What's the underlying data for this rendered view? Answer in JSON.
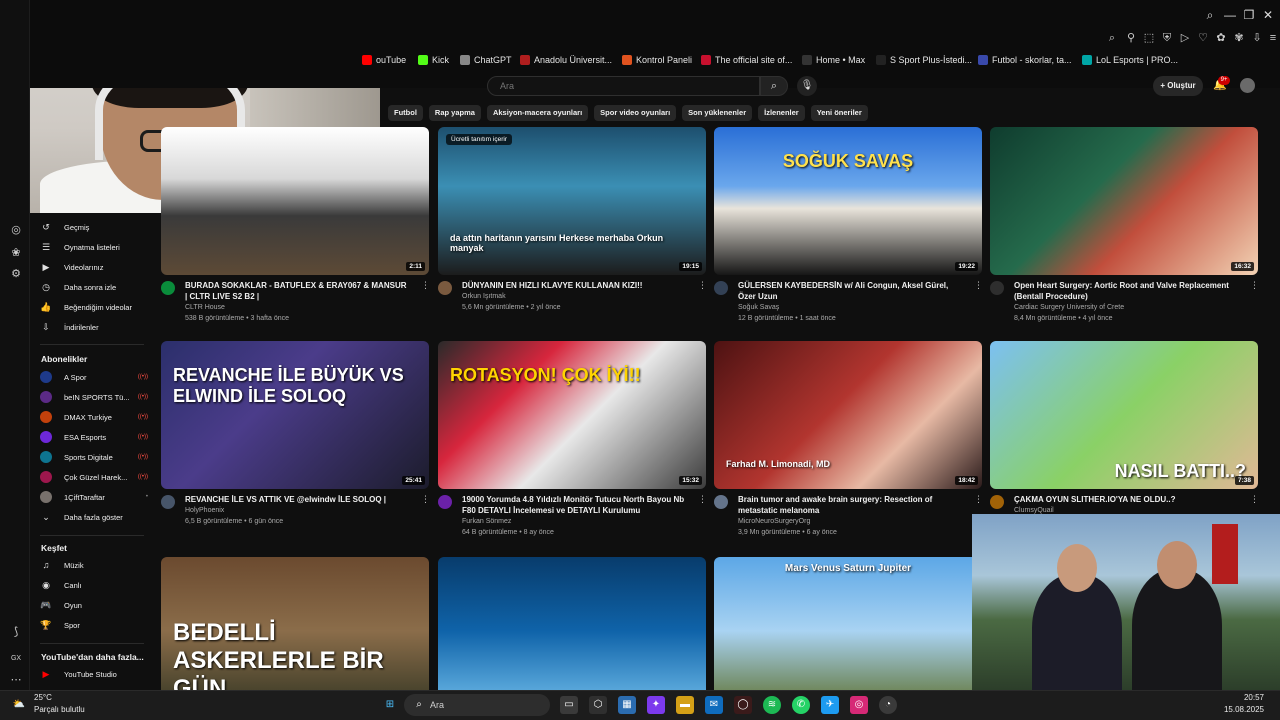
{
  "colors": {
    "bg": "#0f0f0f",
    "chip": "#272727",
    "accent_red": "#ff0000",
    "text": "#f1f1f1",
    "muted": "#aaaaaa"
  },
  "bookmarks": [
    {
      "label": "ouTube",
      "icon": "youtube-icon",
      "color": "#ff0000"
    },
    {
      "label": "Kick",
      "icon": "kick-icon",
      "color": "#53fc18"
    },
    {
      "label": "ChatGPT",
      "icon": "chatgpt-icon",
      "color": "#888888"
    },
    {
      "label": "Anadolu Üniversit...",
      "icon": "university-icon",
      "color": "#b01e1e"
    },
    {
      "label": "Kontrol Paneli",
      "icon": "control-panel-icon",
      "color": "#e0531f"
    },
    {
      "label": "The official site of...",
      "icon": "nba-icon",
      "color": "#c8102e"
    },
    {
      "label": "Home • Max",
      "icon": "max-icon",
      "color": "#333333"
    },
    {
      "label": "S Sport Plus-İstedi...",
      "icon": "ssport-icon",
      "color": "#222222"
    },
    {
      "label": "Futbol - skorlar, ta...",
      "icon": "flashscore-icon",
      "color": "#3949ab"
    },
    {
      "label": "LoL Esports | PRO...",
      "icon": "lolesports-icon",
      "color": "#00a6a6"
    }
  ],
  "search": {
    "placeholder": "Ara"
  },
  "header": {
    "create_label": "Oluştur",
    "notif_count": "9+"
  },
  "chips": [
    "Futbol",
    "Rap yapma",
    "Aksiyon-macera oyunları",
    "Spor video oyunları",
    "Son yüklenenler",
    "İzlenenler",
    "Yeni öneriler"
  ],
  "sidebar": {
    "you_items": [
      {
        "label": "Geçmiş",
        "icon": "history-icon"
      },
      {
        "label": "Oynatma listeleri",
        "icon": "playlist-icon"
      },
      {
        "label": "Videolarınız",
        "icon": "your-videos-icon"
      },
      {
        "label": "Daha sonra izle",
        "icon": "watch-later-icon"
      },
      {
        "label": "Beğendiğim videolar",
        "icon": "liked-icon"
      },
      {
        "label": "İndirilenler",
        "icon": "download-icon"
      }
    ],
    "subs_title": "Abonelikler",
    "subs": [
      {
        "label": "A Spor",
        "color": "#1e3a8a",
        "live": true
      },
      {
        "label": "beIN SPORTS Tü...",
        "color": "#5b2a86",
        "live": true
      },
      {
        "label": "DMAX Turkiye",
        "color": "#c2410c",
        "live": true
      },
      {
        "label": "ESA Esports",
        "color": "#6d28d9",
        "live": true
      },
      {
        "label": "Sports Digitale",
        "color": "#0e7490",
        "live": true
      },
      {
        "label": "Çok Güzel Harek...",
        "color": "#9d174d",
        "live": true
      },
      {
        "label": "1ÇiftTaraftar",
        "color": "#78716c",
        "live": false
      }
    ],
    "more_label": "Daha fazla göster",
    "explore_title": "Keşfet",
    "explore": [
      {
        "label": "Müzik",
        "icon": "music-icon"
      },
      {
        "label": "Canlı",
        "icon": "live-icon"
      },
      {
        "label": "Oyun",
        "icon": "gaming-icon"
      },
      {
        "label": "Spor",
        "icon": "trophy-icon"
      }
    ],
    "more_yt_title": "YouTube'dan daha fazla...",
    "studio_label": "YouTube Studio"
  },
  "videos": [
    {
      "title": "BURADA SOKAKLAR - BATUFLEX & ERAY067 & MANSUR | CLTR LIVE S2 B2 |",
      "channel": "CLTR House",
      "meta": "538 B görüntüleme • 3 hafta önce",
      "duration": "2:11",
      "thumb_text": ""
    },
    {
      "title": "DÜNYANIN EN HIZLI KLAVYE KULLANAN KIZI!!",
      "channel": "Orkun Işıtmak",
      "meta": "5,6 Mn görüntüleme • 2 yıl önce",
      "duration": "19:15",
      "thumb_text": "da attın haritanın yarısını Herkese merhaba Orkun manyak",
      "badge": "Ücretli tanıtım içerir"
    },
    {
      "title": "GÜLERSEN KAYBEDERSİN w/ Ali Congun, Aksel Gürel, Özer Uzun",
      "channel": "Soğuk Savaş",
      "meta": "12 B görüntüleme • 1 saat önce",
      "duration": "19:22",
      "thumb_text": "SOĞUK SAVAŞ"
    },
    {
      "title": "Open Heart Surgery: Aortic Root and Valve Replacement (Bentall Procedure)",
      "channel": "Cardiac Surgery University of Crete",
      "meta": "8,4 Mn görüntüleme • 4 yıl önce",
      "duration": "16:32",
      "thumb_text": ""
    },
    {
      "title": "REVANCHE İLE VS ATTIK VE @elwindw İLE SOLOQ |",
      "channel": "HolyPhoenix",
      "meta": "6,5 B görüntüleme • 6 gün önce",
      "duration": "25:41",
      "thumb_text": "REVANCHE İLE BÜYÜK VS ELWIND İLE SOLOQ",
      "title2": "HolyPhoenix"
    },
    {
      "title": "19000 Yorumda 4.8 Yıldızlı Monitör Tutucu North Bayou Nb F80 DETAYLI İncelemesi ve DETAYLI Kurulumu",
      "channel": "Furkan Sönmez",
      "meta": "64 B görüntüleme • 8 ay önce",
      "duration": "15:32",
      "thumb_text": "ROTASYON! ÇOK İYİ!!"
    },
    {
      "title": "Brain tumor and awake brain surgery: Resection of metastatic melanoma",
      "channel": "MicroNeuroSurgeryOrg",
      "meta": "3,9 Mn görüntüleme • 6 ay önce",
      "duration": "18:42",
      "thumb_text": "Farhad M. Limonadi, MD"
    },
    {
      "title": "ÇAKMA OYUN SLITHER.IO'YA NE OLDU..?",
      "channel": "ClumsyQuail",
      "meta": "",
      "duration": "7:38",
      "thumb_text": "NASIL BATTI..?"
    },
    {
      "title": "",
      "channel": "",
      "meta": "",
      "duration": "",
      "thumb_text": "BEDELLİ ASKERLERLE BİR GÜN"
    },
    {
      "title": "",
      "channel": "",
      "meta": "",
      "duration": "",
      "thumb_text": ""
    },
    {
      "title": "",
      "channel": "",
      "meta": "",
      "duration": "",
      "thumb_text": "Mars Venus Saturn Jupiter",
      "planets": [
        "Mars",
        "Venus",
        "Saturn",
        "Jupiter"
      ]
    }
  ],
  "taskbar": {
    "temp": "25°C",
    "weather": "Parçalı bulutlu",
    "search_placeholder": "Ara",
    "time": "20:57",
    "date": "15.08.2025"
  },
  "rail": {
    "gx_label": "GX"
  }
}
